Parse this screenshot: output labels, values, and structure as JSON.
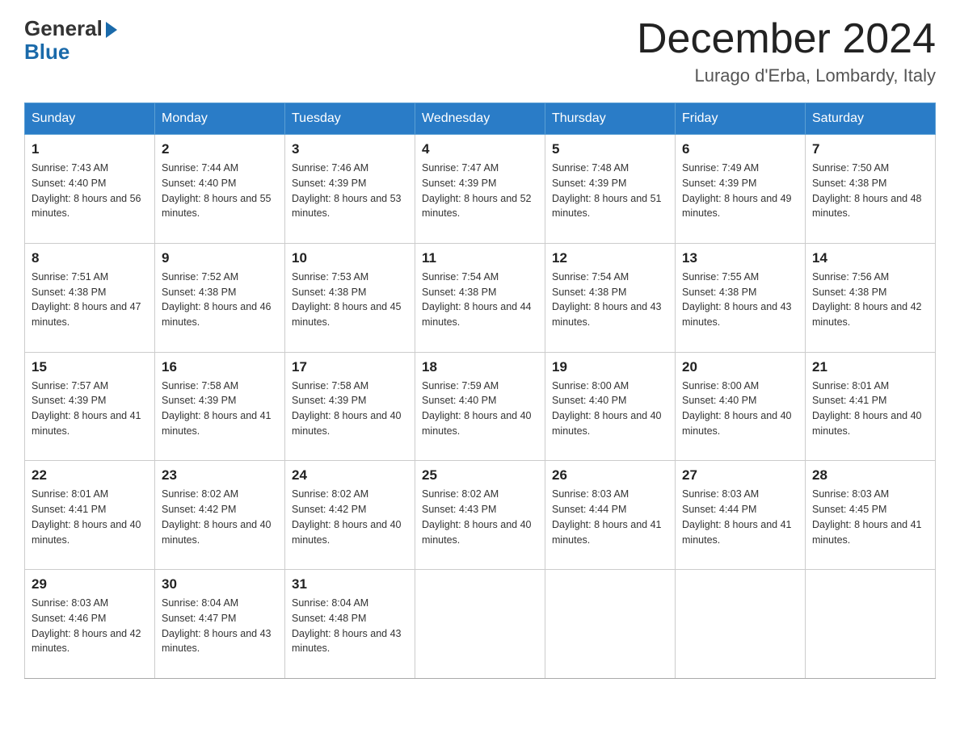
{
  "logo": {
    "general": "General",
    "blue": "Blue"
  },
  "title": "December 2024",
  "location": "Lurago d'Erba, Lombardy, Italy",
  "days_of_week": [
    "Sunday",
    "Monday",
    "Tuesday",
    "Wednesday",
    "Thursday",
    "Friday",
    "Saturday"
  ],
  "weeks": [
    [
      {
        "day": "1",
        "sunrise": "7:43 AM",
        "sunset": "4:40 PM",
        "daylight": "8 hours and 56 minutes."
      },
      {
        "day": "2",
        "sunrise": "7:44 AM",
        "sunset": "4:40 PM",
        "daylight": "8 hours and 55 minutes."
      },
      {
        "day": "3",
        "sunrise": "7:46 AM",
        "sunset": "4:39 PM",
        "daylight": "8 hours and 53 minutes."
      },
      {
        "day": "4",
        "sunrise": "7:47 AM",
        "sunset": "4:39 PM",
        "daylight": "8 hours and 52 minutes."
      },
      {
        "day": "5",
        "sunrise": "7:48 AM",
        "sunset": "4:39 PM",
        "daylight": "8 hours and 51 minutes."
      },
      {
        "day": "6",
        "sunrise": "7:49 AM",
        "sunset": "4:39 PM",
        "daylight": "8 hours and 49 minutes."
      },
      {
        "day": "7",
        "sunrise": "7:50 AM",
        "sunset": "4:38 PM",
        "daylight": "8 hours and 48 minutes."
      }
    ],
    [
      {
        "day": "8",
        "sunrise": "7:51 AM",
        "sunset": "4:38 PM",
        "daylight": "8 hours and 47 minutes."
      },
      {
        "day": "9",
        "sunrise": "7:52 AM",
        "sunset": "4:38 PM",
        "daylight": "8 hours and 46 minutes."
      },
      {
        "day": "10",
        "sunrise": "7:53 AM",
        "sunset": "4:38 PM",
        "daylight": "8 hours and 45 minutes."
      },
      {
        "day": "11",
        "sunrise": "7:54 AM",
        "sunset": "4:38 PM",
        "daylight": "8 hours and 44 minutes."
      },
      {
        "day": "12",
        "sunrise": "7:54 AM",
        "sunset": "4:38 PM",
        "daylight": "8 hours and 43 minutes."
      },
      {
        "day": "13",
        "sunrise": "7:55 AM",
        "sunset": "4:38 PM",
        "daylight": "8 hours and 43 minutes."
      },
      {
        "day": "14",
        "sunrise": "7:56 AM",
        "sunset": "4:38 PM",
        "daylight": "8 hours and 42 minutes."
      }
    ],
    [
      {
        "day": "15",
        "sunrise": "7:57 AM",
        "sunset": "4:39 PM",
        "daylight": "8 hours and 41 minutes."
      },
      {
        "day": "16",
        "sunrise": "7:58 AM",
        "sunset": "4:39 PM",
        "daylight": "8 hours and 41 minutes."
      },
      {
        "day": "17",
        "sunrise": "7:58 AM",
        "sunset": "4:39 PM",
        "daylight": "8 hours and 40 minutes."
      },
      {
        "day": "18",
        "sunrise": "7:59 AM",
        "sunset": "4:40 PM",
        "daylight": "8 hours and 40 minutes."
      },
      {
        "day": "19",
        "sunrise": "8:00 AM",
        "sunset": "4:40 PM",
        "daylight": "8 hours and 40 minutes."
      },
      {
        "day": "20",
        "sunrise": "8:00 AM",
        "sunset": "4:40 PM",
        "daylight": "8 hours and 40 minutes."
      },
      {
        "day": "21",
        "sunrise": "8:01 AM",
        "sunset": "4:41 PM",
        "daylight": "8 hours and 40 minutes."
      }
    ],
    [
      {
        "day": "22",
        "sunrise": "8:01 AM",
        "sunset": "4:41 PM",
        "daylight": "8 hours and 40 minutes."
      },
      {
        "day": "23",
        "sunrise": "8:02 AM",
        "sunset": "4:42 PM",
        "daylight": "8 hours and 40 minutes."
      },
      {
        "day": "24",
        "sunrise": "8:02 AM",
        "sunset": "4:42 PM",
        "daylight": "8 hours and 40 minutes."
      },
      {
        "day": "25",
        "sunrise": "8:02 AM",
        "sunset": "4:43 PM",
        "daylight": "8 hours and 40 minutes."
      },
      {
        "day": "26",
        "sunrise": "8:03 AM",
        "sunset": "4:44 PM",
        "daylight": "8 hours and 41 minutes."
      },
      {
        "day": "27",
        "sunrise": "8:03 AM",
        "sunset": "4:44 PM",
        "daylight": "8 hours and 41 minutes."
      },
      {
        "day": "28",
        "sunrise": "8:03 AM",
        "sunset": "4:45 PM",
        "daylight": "8 hours and 41 minutes."
      }
    ],
    [
      {
        "day": "29",
        "sunrise": "8:03 AM",
        "sunset": "4:46 PM",
        "daylight": "8 hours and 42 minutes."
      },
      {
        "day": "30",
        "sunrise": "8:04 AM",
        "sunset": "4:47 PM",
        "daylight": "8 hours and 43 minutes."
      },
      {
        "day": "31",
        "sunrise": "8:04 AM",
        "sunset": "4:48 PM",
        "daylight": "8 hours and 43 minutes."
      },
      null,
      null,
      null,
      null
    ]
  ]
}
